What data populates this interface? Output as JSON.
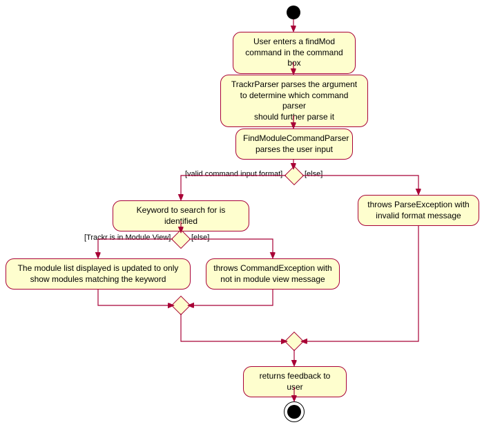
{
  "chart_data": {
    "type": "activity-diagram",
    "title": "",
    "nodes": [
      {
        "id": "start",
        "type": "start"
      },
      {
        "id": "n1",
        "text": "User enters a findMod\ncommand in the command box"
      },
      {
        "id": "n2",
        "text": "TrackrParser parses the argument\nto determine which command parser\nshould further parse it"
      },
      {
        "id": "n3",
        "text": "FindModuleCommandParser\nparses the user input"
      },
      {
        "id": "d1",
        "type": "decision",
        "guards": [
          "[valid command input format]",
          "[else]"
        ]
      },
      {
        "id": "n4",
        "text": "Keyword to search for is identified"
      },
      {
        "id": "n5",
        "text": "throws ParseException with\ninvalid format message"
      },
      {
        "id": "d2",
        "type": "decision",
        "guards": [
          "[Trackr is in Module View]",
          "[else]"
        ]
      },
      {
        "id": "n6",
        "text": "The module list displayed is updated to only\nshow modules matching the keyword"
      },
      {
        "id": "n7",
        "text": "throws CommandException with\nnot in module view message"
      },
      {
        "id": "m1",
        "type": "merge"
      },
      {
        "id": "m2",
        "type": "merge"
      },
      {
        "id": "n8",
        "text": "returns feedback to user"
      },
      {
        "id": "end",
        "type": "end"
      }
    ],
    "edges": [
      {
        "from": "start",
        "to": "n1"
      },
      {
        "from": "n1",
        "to": "n2"
      },
      {
        "from": "n2",
        "to": "n3"
      },
      {
        "from": "n3",
        "to": "d1"
      },
      {
        "from": "d1",
        "to": "n4",
        "guard": "[valid command input format]"
      },
      {
        "from": "d1",
        "to": "n5",
        "guard": "[else]"
      },
      {
        "from": "n4",
        "to": "d2"
      },
      {
        "from": "d2",
        "to": "n6",
        "guard": "[Trackr is in Module View]"
      },
      {
        "from": "d2",
        "to": "n7",
        "guard": "[else]"
      },
      {
        "from": "n6",
        "to": "m1"
      },
      {
        "from": "n7",
        "to": "m1"
      },
      {
        "from": "m1",
        "to": "m2"
      },
      {
        "from": "n5",
        "to": "m2"
      },
      {
        "from": "m2",
        "to": "n8"
      },
      {
        "from": "n8",
        "to": "end"
      }
    ]
  },
  "labels": {
    "n1_l1": "User enters a findMod",
    "n1_l2": "command in the command box",
    "n2_l1": "TrackrParser parses the argument",
    "n2_l2": "to determine which command parser",
    "n2_l3": "should further parse it",
    "n3_l1": "FindModuleCommandParser",
    "n3_l2": "parses the user input",
    "n4": "Keyword to search for is identified",
    "n5_l1": "throws ParseException with",
    "n5_l2": "invalid format message",
    "n6_l1": "The module list displayed is updated to only",
    "n6_l2": "show modules matching the keyword",
    "n7_l1": "throws CommandException with",
    "n7_l2": "not in module view message",
    "n8": "returns feedback to user",
    "g_valid": "[valid command input format]",
    "g_else1": "[else]",
    "g_moduleview": "[Trackr is in Module View]",
    "g_else2": "[else]"
  }
}
